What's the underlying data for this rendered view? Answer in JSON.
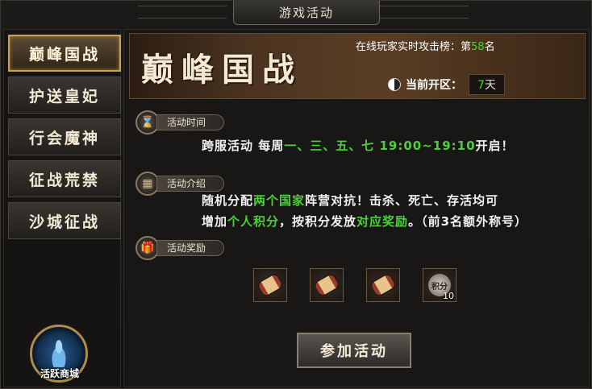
{
  "window": {
    "title": "游戏活动"
  },
  "sidebar": {
    "tabs": [
      {
        "label": "巅峰国战",
        "active": true
      },
      {
        "label": "护送皇妃",
        "active": false
      },
      {
        "label": "行会魔神",
        "active": false
      },
      {
        "label": "征战荒禁",
        "active": false
      },
      {
        "label": "沙城征战",
        "active": false
      }
    ],
    "shop_label": "活跃商城"
  },
  "banner": {
    "title": "巅峰国战",
    "rank_prefix": "在线玩家实时攻击榜：第",
    "rank_value": "58",
    "rank_suffix": "名",
    "server_label": "当前开区：",
    "server_value": "7",
    "server_unit": "天"
  },
  "sections": {
    "time": {
      "label": "活动时间",
      "t1": "跨服活动 每周",
      "t2": "一、三、五、七 19:00~19:10",
      "t3": "开启！"
    },
    "intro": {
      "label": "活动介绍",
      "l1a": "随机分配",
      "l1b": "两个国家",
      "l1c": "阵营对抗！击杀、死亡、存活均可",
      "l2a": "增加",
      "l2b": "个人积分",
      "l2c": "，按积分发放",
      "l2d": "对应奖励",
      "l2e": "。（前3名额外称号）"
    },
    "rewards": {
      "label": "活动奖励",
      "items": [
        {
          "icon": "scroll-icon",
          "count": ""
        },
        {
          "icon": "scroll-icon",
          "count": ""
        },
        {
          "icon": "scroll-icon",
          "count": ""
        },
        {
          "icon": "points-icon",
          "icon_text": "积分",
          "count": "10"
        }
      ]
    }
  },
  "join_button": "参加活动",
  "colors": {
    "highlight": "#4cd03a",
    "gold_border": "#c8a25a"
  }
}
